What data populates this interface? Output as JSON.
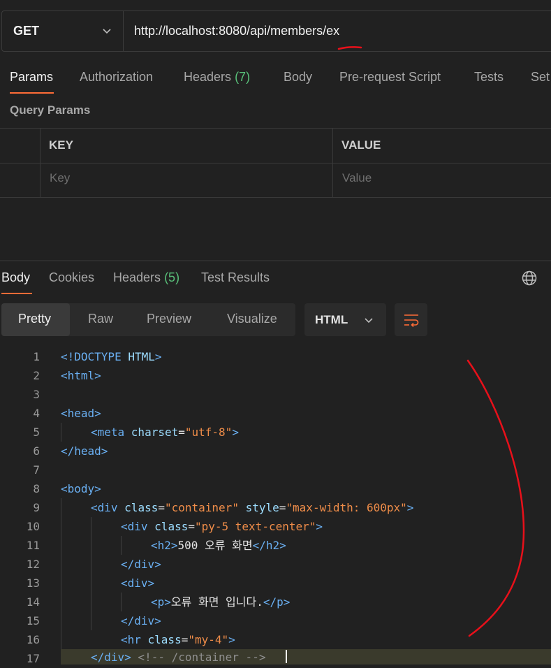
{
  "request": {
    "method": "GET",
    "url": "http://localhost:8080/api/members/ex",
    "tabs": {
      "params": "Params",
      "authorization": "Authorization",
      "headers": "Headers",
      "headers_count": "(7)",
      "body": "Body",
      "prerequest": "Pre-request Script",
      "tests": "Tests",
      "settings": "Set"
    },
    "query_params_title": "Query Params",
    "table": {
      "key_header": "KEY",
      "value_header": "VALUE",
      "key_placeholder": "Key",
      "value_placeholder": "Value"
    }
  },
  "response": {
    "tabs": {
      "body": "Body",
      "cookies": "Cookies",
      "headers": "Headers",
      "headers_count": "(5)",
      "test_results": "Test Results"
    },
    "view_modes": {
      "pretty": "Pretty",
      "raw": "Raw",
      "preview": "Preview",
      "visualize": "Visualize"
    },
    "format": "HTML",
    "line_numbers": [
      "1",
      "2",
      "3",
      "4",
      "5",
      "6",
      "7",
      "8",
      "9",
      "10",
      "11",
      "12",
      "13",
      "14",
      "15",
      "16",
      "17"
    ],
    "code": {
      "l1_a": "<!DOCTYPE ",
      "l1_b": "HTML",
      "l1_c": ">",
      "l2": "<html>",
      "l4": "<head>",
      "l5_tag": "<meta ",
      "l5_attr": "charset",
      "l5_eq": "=",
      "l5_val": "\"utf-8\"",
      "l5_end": ">",
      "l6": "</head>",
      "l8": "<body>",
      "l9_tag": "<div ",
      "l9_attr1": "class",
      "l9_eq1": "=",
      "l9_val1": "\"container\"",
      "l9_sp": " ",
      "l9_attr2": "style",
      "l9_eq2": "=",
      "l9_val2": "\"max-width: 600px\"",
      "l9_end": ">",
      "l10_tag": "<div ",
      "l10_attr": "class",
      "l10_eq": "=",
      "l10_val": "\"py-5 text-center\"",
      "l10_end": ">",
      "l11_open": "<h2>",
      "l11_text": "500 오류 화면",
      "l11_close": "</h2>",
      "l12": "</div>",
      "l13": "<div>",
      "l14_open": "<p>",
      "l14_text": "오류 화면 입니다.",
      "l14_close": "</p>",
      "l15": "</div>",
      "l16_tag": "<hr ",
      "l16_attr": "class",
      "l16_eq": "=",
      "l16_val": "\"my-4\"",
      "l16_end": ">",
      "l17_tag": "</div>",
      "l17_cmt": " <!-- /container -->"
    }
  },
  "colors": {
    "accent": "#ff6c37",
    "background": "#212121",
    "annotation": "#e8101a"
  },
  "icons": [
    "chevron-down-icon",
    "globe-icon",
    "wrap-lines-icon"
  ]
}
